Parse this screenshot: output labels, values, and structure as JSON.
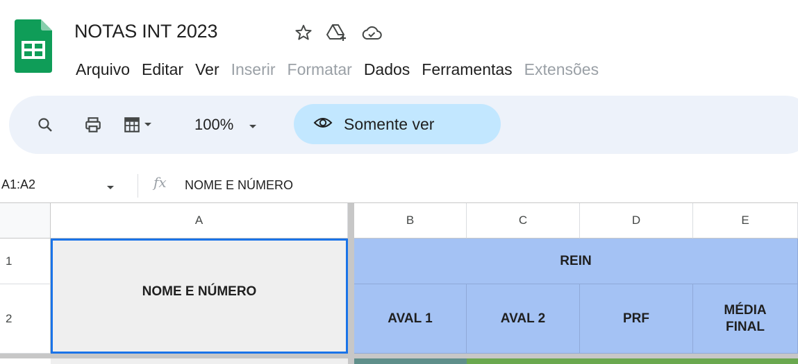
{
  "header": {
    "title": "NOTAS INT 2023",
    "menu": [
      {
        "label": "Arquivo",
        "enabled": true
      },
      {
        "label": "Editar",
        "enabled": true
      },
      {
        "label": "Ver",
        "enabled": true
      },
      {
        "label": "Inserir",
        "enabled": false
      },
      {
        "label": "Formatar",
        "enabled": false
      },
      {
        "label": "Dados",
        "enabled": true
      },
      {
        "label": "Ferramentas",
        "enabled": true
      },
      {
        "label": "Extensões",
        "enabled": false
      }
    ],
    "icons": [
      "star-icon",
      "add-shortcut-to-drive-icon",
      "cloud-saved-icon"
    ]
  },
  "toolbar": {
    "zoom": "100%",
    "view_mode": "Somente ver",
    "icons": [
      "search-icon",
      "print-icon",
      "format-table-icon",
      "chevron-down-icon",
      "eye-icon"
    ]
  },
  "formula_bar": {
    "name_box": "A1:A2",
    "fx": "fx",
    "content": "NOME E NÚMERO"
  },
  "grid": {
    "columns": [
      "A",
      "B",
      "C",
      "D",
      "E"
    ],
    "rows": [
      "1",
      "2"
    ],
    "cells": {
      "A1_A2": "NOME E NÚMERO",
      "B1_E1": "REIN",
      "B2": "AVAL 1",
      "C2": "AVAL 2",
      "D2": "PRF",
      "E2": "MÉDIA FINAL"
    },
    "colors": {
      "header_fill": "#a4c2f4",
      "name_fill": "#efefef",
      "selection": "#1a73e8",
      "row3_b": "#5f8f8a",
      "row3_c_e": "#6aa84f"
    }
  },
  "colors": {
    "sheets_green": "#0f9d58",
    "toolbar_bg": "#edf2fa",
    "chip_bg": "#c2e7ff",
    "disabled_text": "#9aa0a6"
  }
}
